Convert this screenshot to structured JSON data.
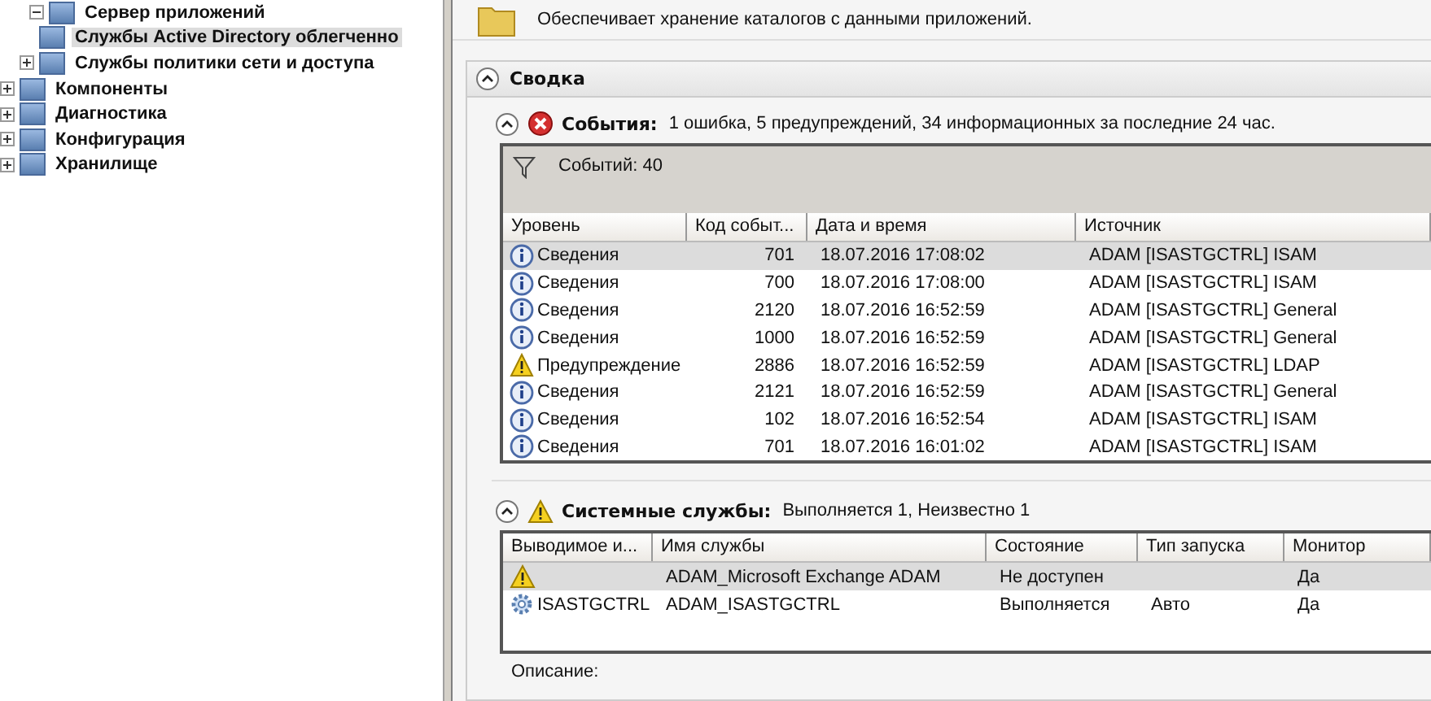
{
  "tree": [
    {
      "label": "Сервер приложений",
      "expanded": true,
      "selected": false,
      "children": [
        {
          "label": "Службы Active Directory облегченно",
          "selected": true,
          "has_children": false
        },
        {
          "label": "Службы политики сети и доступа",
          "selected": false,
          "has_children": true,
          "expanded": false
        }
      ]
    },
    {
      "label": "Компоненты",
      "expanded": false,
      "selected": false
    },
    {
      "label": "Диагностика",
      "expanded": false,
      "selected": false
    },
    {
      "label": "Конфигурация",
      "expanded": false,
      "selected": false
    },
    {
      "label": "Хранилище",
      "expanded": false,
      "selected": false
    }
  ],
  "description": "Обеспечивает хранение каталогов с данными приложений.",
  "summary": {
    "title": "Сводка",
    "expanded": true
  },
  "events": {
    "title": "События:",
    "text": "1 ошибка, 5 предупреждений, 34 информационных за последние 24 час.",
    "filter_text": "Событий: 40",
    "columns": [
      "Уровень",
      "Код событ...",
      "Дата и время",
      "Источник"
    ],
    "rows": [
      {
        "kind": "info",
        "level": "Сведения",
        "code": "701",
        "date": "18.07.2016 17:08:02",
        "source": "ADAM [ISASTGCTRL] ISAM",
        "selected": true
      },
      {
        "kind": "info",
        "level": "Сведения",
        "code": "700",
        "date": "18.07.2016 17:08:00",
        "source": "ADAM [ISASTGCTRL] ISAM",
        "selected": false
      },
      {
        "kind": "info",
        "level": "Сведения",
        "code": "2120",
        "date": "18.07.2016 16:52:59",
        "source": "ADAM [ISASTGCTRL] General",
        "selected": false
      },
      {
        "kind": "info",
        "level": "Сведения",
        "code": "1000",
        "date": "18.07.2016 16:52:59",
        "source": "ADAM [ISASTGCTRL] General",
        "selected": false
      },
      {
        "kind": "warning",
        "level": "Предупреждение",
        "code": "2886",
        "date": "18.07.2016 16:52:59",
        "source": "ADAM [ISASTGCTRL] LDAP",
        "selected": false
      },
      {
        "kind": "info",
        "level": "Сведения",
        "code": "2121",
        "date": "18.07.2016 16:52:59",
        "source": "ADAM [ISASTGCTRL] General",
        "selected": false
      },
      {
        "kind": "info",
        "level": "Сведения",
        "code": "102",
        "date": "18.07.2016 16:52:54",
        "source": "ADAM [ISASTGCTRL] ISAM",
        "selected": false
      },
      {
        "kind": "info",
        "level": "Сведения",
        "code": "701",
        "date": "18.07.2016 16:01:02",
        "source": "ADAM [ISASTGCTRL] ISAM",
        "selected": false
      }
    ]
  },
  "services": {
    "title": "Системные службы:",
    "text": "Выполняется 1, Неизвестно 1",
    "columns": [
      "Выводимое и...",
      "Имя службы",
      "Состояние",
      "Тип запуска",
      "Монитор"
    ],
    "rows": [
      {
        "kind": "warning",
        "name": "ADAM_Microsoft Exchange ADAM",
        "state": "Не доступен",
        "monitor": "Да",
        "selected": true
      },
      {
        "kind": "service",
        "display": "ISASTGCTRL",
        "name": "ADAM_ISASTGCTRL",
        "state": "Выполняется",
        "startup": "Авто",
        "monitor": "Да",
        "selected": false
      }
    ],
    "description_label": "Описание:"
  }
}
